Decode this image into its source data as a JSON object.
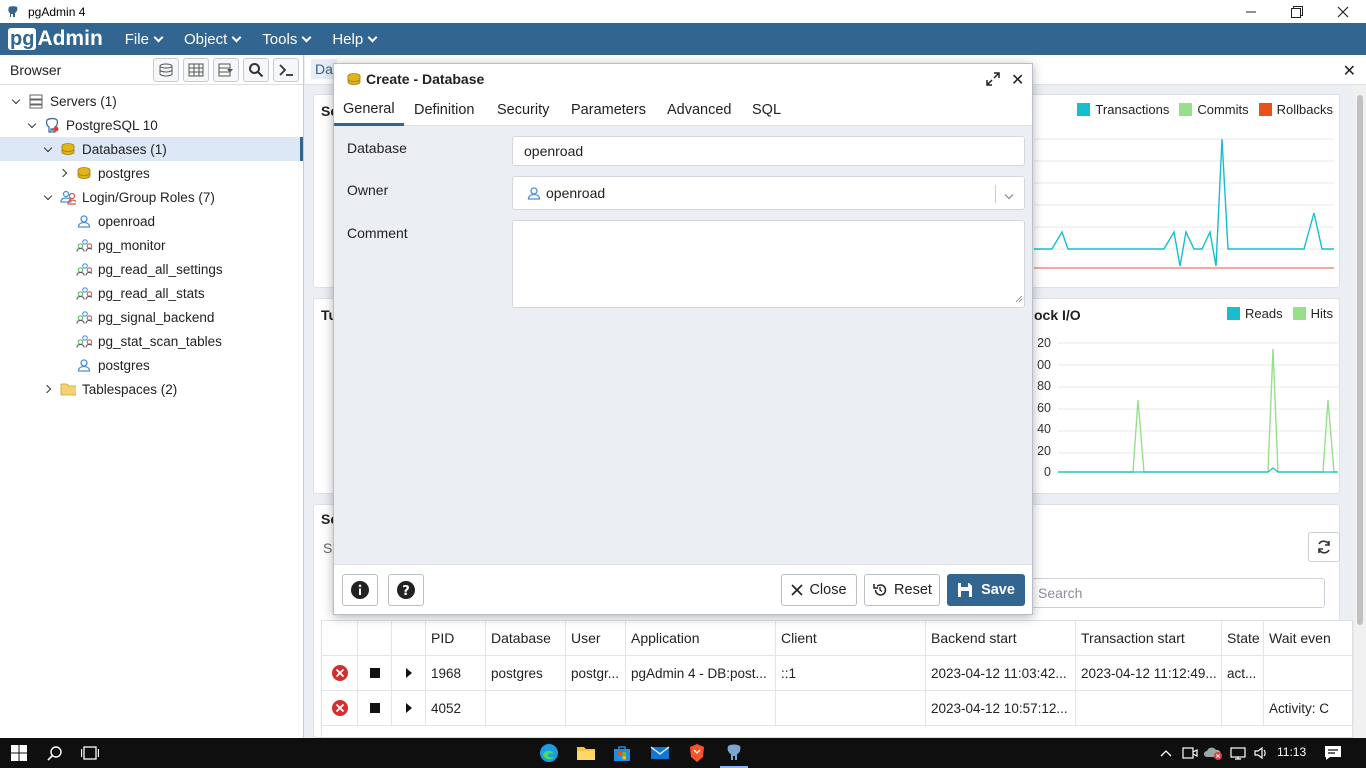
{
  "window": {
    "title": "pgAdmin 4"
  },
  "menubar": {
    "logo_pg": "pg",
    "logo_admin": "Admin",
    "items": [
      "File",
      "Object",
      "Tools",
      "Help"
    ]
  },
  "browser": {
    "title": "Browser",
    "tree": [
      {
        "label": "Servers (1)",
        "level": 0,
        "toggle": "down",
        "icon": "servers-icon"
      },
      {
        "label": "PostgreSQL 10",
        "level": 1,
        "toggle": "down",
        "icon": "elephant-icon"
      },
      {
        "label": "Databases (1)",
        "level": 2,
        "toggle": "down",
        "icon": "databases-icon",
        "selected": true
      },
      {
        "label": "postgres",
        "level": 3,
        "toggle": "right",
        "icon": "database-icon"
      },
      {
        "label": "Login/Group Roles (7)",
        "level": 2,
        "toggle": "down",
        "icon": "roles-icon"
      },
      {
        "label": "openroad",
        "level": 3,
        "toggle": "",
        "icon": "user-icon"
      },
      {
        "label": "pg_monitor",
        "level": 3,
        "toggle": "",
        "icon": "group-icon"
      },
      {
        "label": "pg_read_all_settings",
        "level": 3,
        "toggle": "",
        "icon": "group-icon"
      },
      {
        "label": "pg_read_all_stats",
        "level": 3,
        "toggle": "",
        "icon": "group-icon"
      },
      {
        "label": "pg_signal_backend",
        "level": 3,
        "toggle": "",
        "icon": "group-icon"
      },
      {
        "label": "pg_stat_scan_tables",
        "level": 3,
        "toggle": "",
        "icon": "group-icon"
      },
      {
        "label": "postgres",
        "level": 3,
        "toggle": "",
        "icon": "user-icon"
      },
      {
        "label": "Tablespaces (2)",
        "level": 2,
        "toggle": "right",
        "icon": "folder-icon"
      }
    ]
  },
  "main": {
    "tab_label": "Da",
    "card1_title": "Se",
    "card2_title": "Tu",
    "card3_title": "ock I/O",
    "card4_title": "Se",
    "subtab": "S",
    "legend1": [
      {
        "label": "Transactions",
        "color": "#17becf"
      },
      {
        "label": "Commits",
        "color": "#98df8a"
      },
      {
        "label": "Rollbacks",
        "color": "#e8521a"
      }
    ],
    "legend2": [
      {
        "label": "Reads",
        "color": "#17becf"
      },
      {
        "label": "Hits",
        "color": "#98df8a"
      }
    ],
    "io_ticks": [
      "20",
      "00",
      "80",
      "60",
      "40",
      "20",
      "0"
    ],
    "search_placeholder": "Search",
    "table": {
      "headers": [
        "PID",
        "Database",
        "User",
        "Application",
        "Client",
        "Backend start",
        "Transaction start",
        "State",
        "Wait even"
      ],
      "rows": [
        [
          "1968",
          "postgres",
          "postgr...",
          "pgAdmin 4 - DB:post...",
          "::1",
          "2023-04-12 11:03:42...",
          "2023-04-12 11:12:49...",
          "act...",
          ""
        ],
        [
          "4052",
          "",
          "",
          "",
          "",
          "2023-04-12 10:57:12...",
          "",
          "",
          "Activity: C"
        ]
      ]
    }
  },
  "dialog": {
    "title": "Create - Database",
    "tabs": [
      "General",
      "Definition",
      "Security",
      "Parameters",
      "Advanced",
      "SQL"
    ],
    "fields": {
      "database_label": "Database",
      "database_value": "openroad",
      "owner_label": "Owner",
      "owner_value": "openroad",
      "comment_label": "Comment",
      "comment_value": ""
    },
    "buttons": {
      "close": "Close",
      "reset": "Reset",
      "save": "Save"
    }
  },
  "taskbar": {
    "time": "11:13"
  }
}
